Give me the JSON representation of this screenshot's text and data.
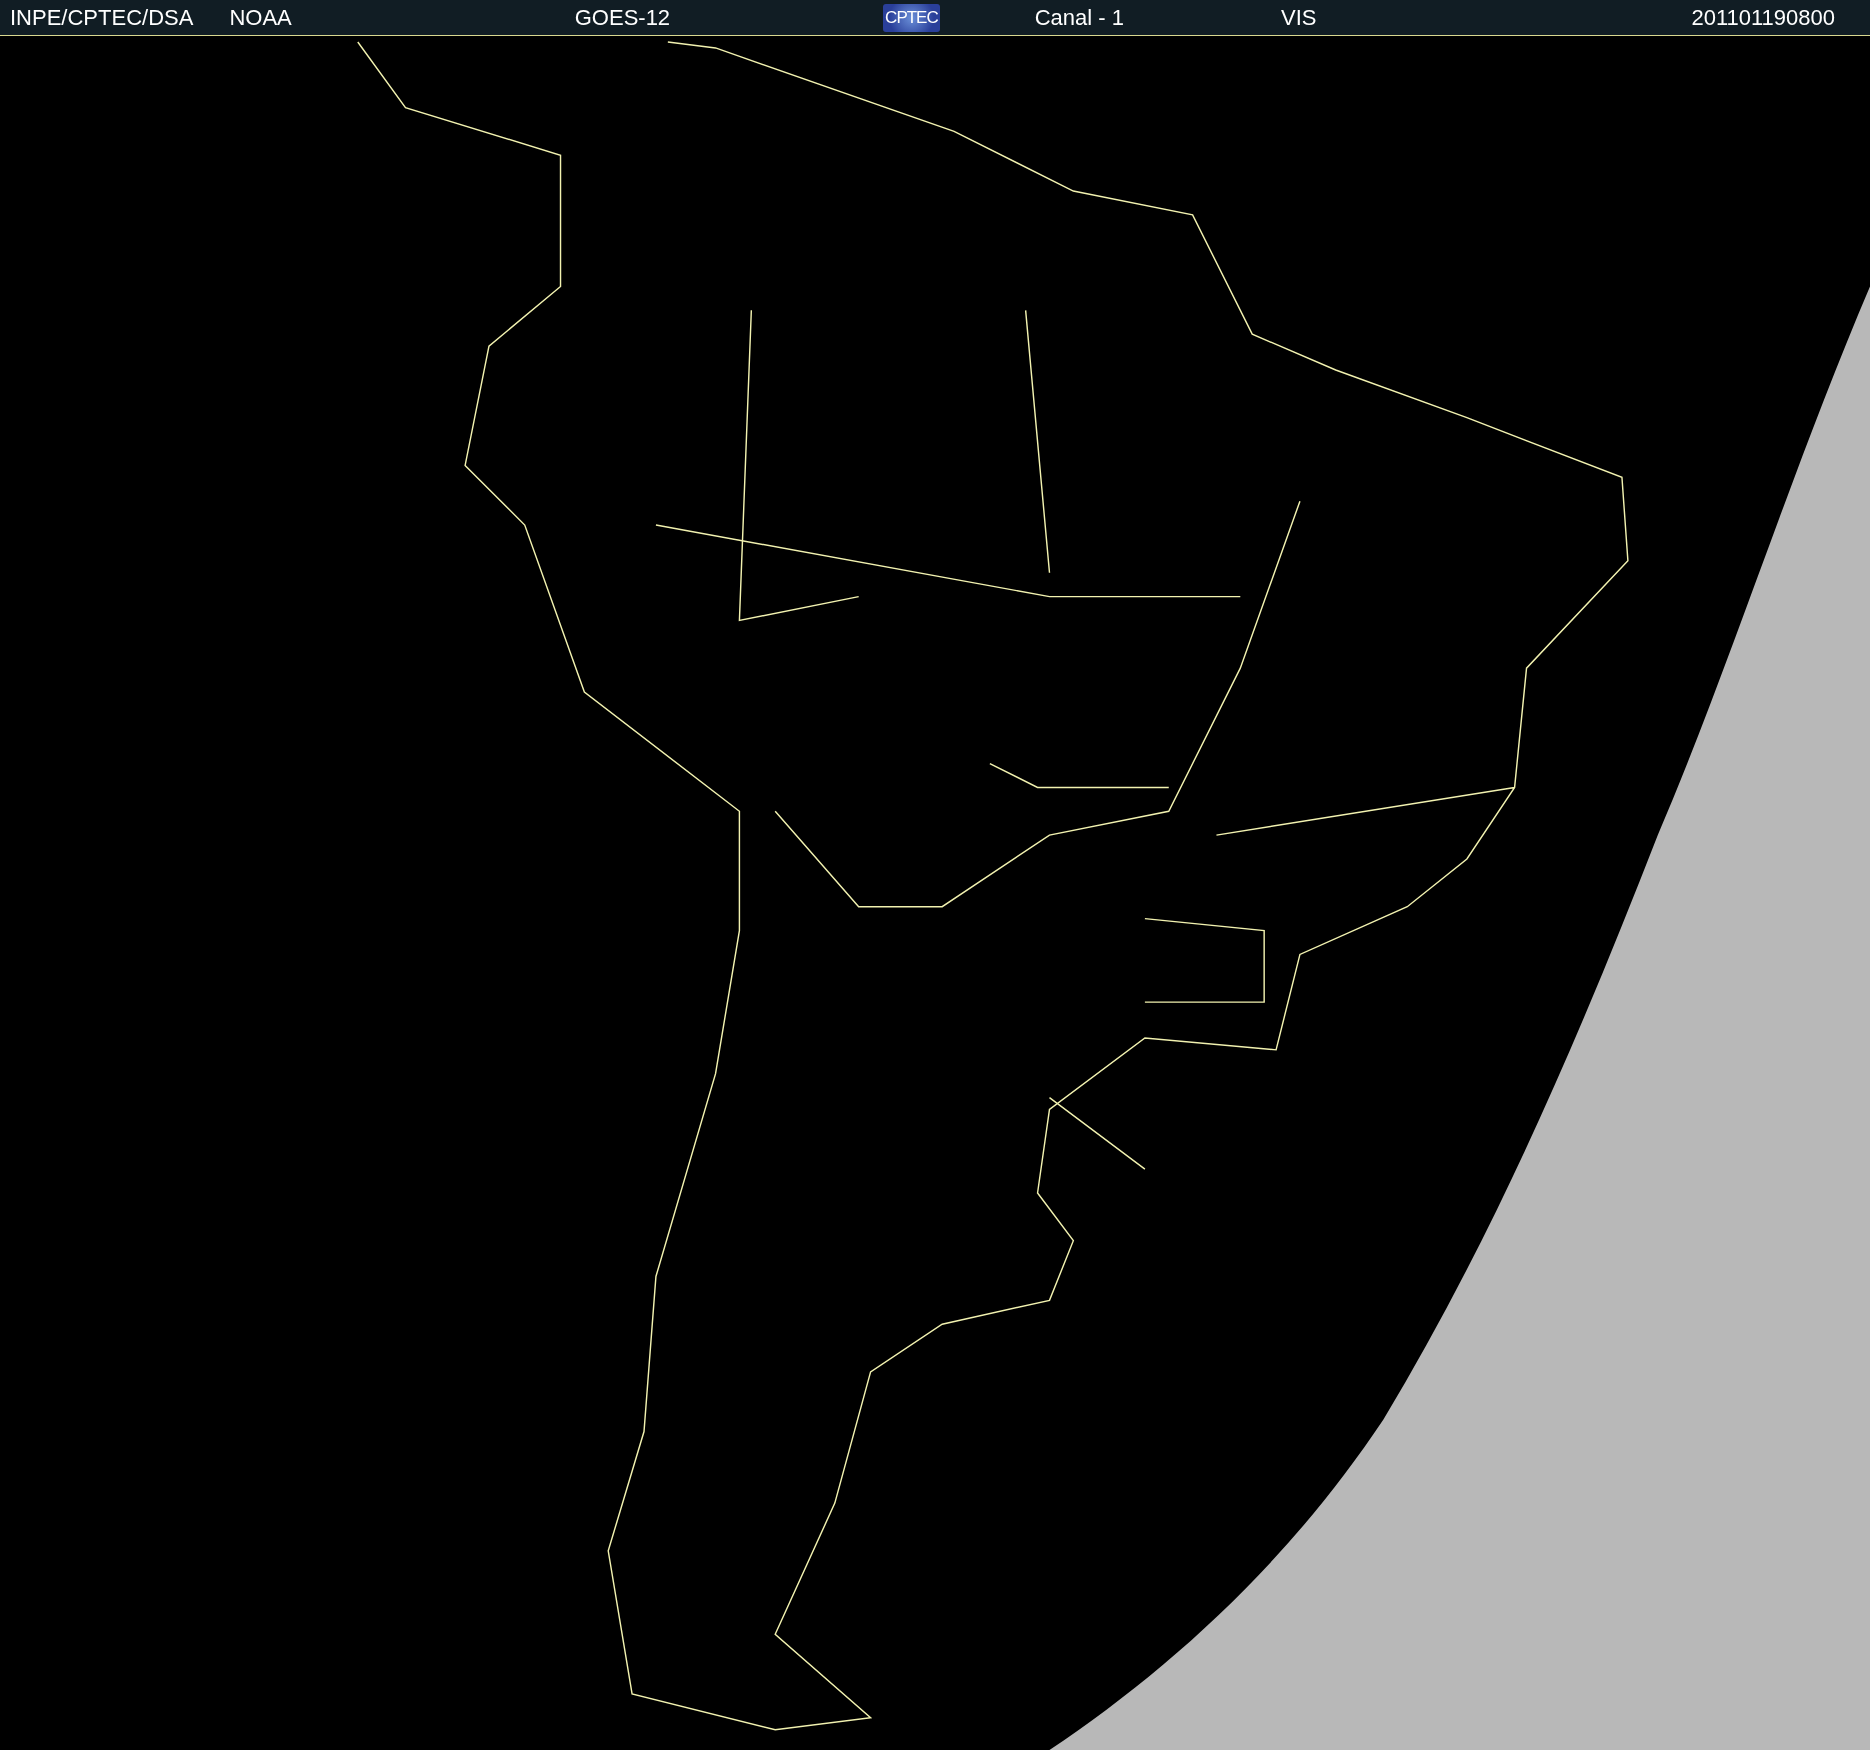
{
  "header": {
    "items": [
      {
        "kind": "text",
        "text": "INPE/CPTEC/DSA"
      },
      {
        "kind": "text",
        "text": "NOAA"
      },
      {
        "kind": "text",
        "text": "GOES-12"
      },
      {
        "kind": "logo",
        "text": "CPTEC"
      },
      {
        "kind": "text",
        "text": "Canal - 1"
      },
      {
        "kind": "text",
        "text": "VIS"
      },
      {
        "kind": "text",
        "text": "201101190800"
      }
    ]
  }
}
